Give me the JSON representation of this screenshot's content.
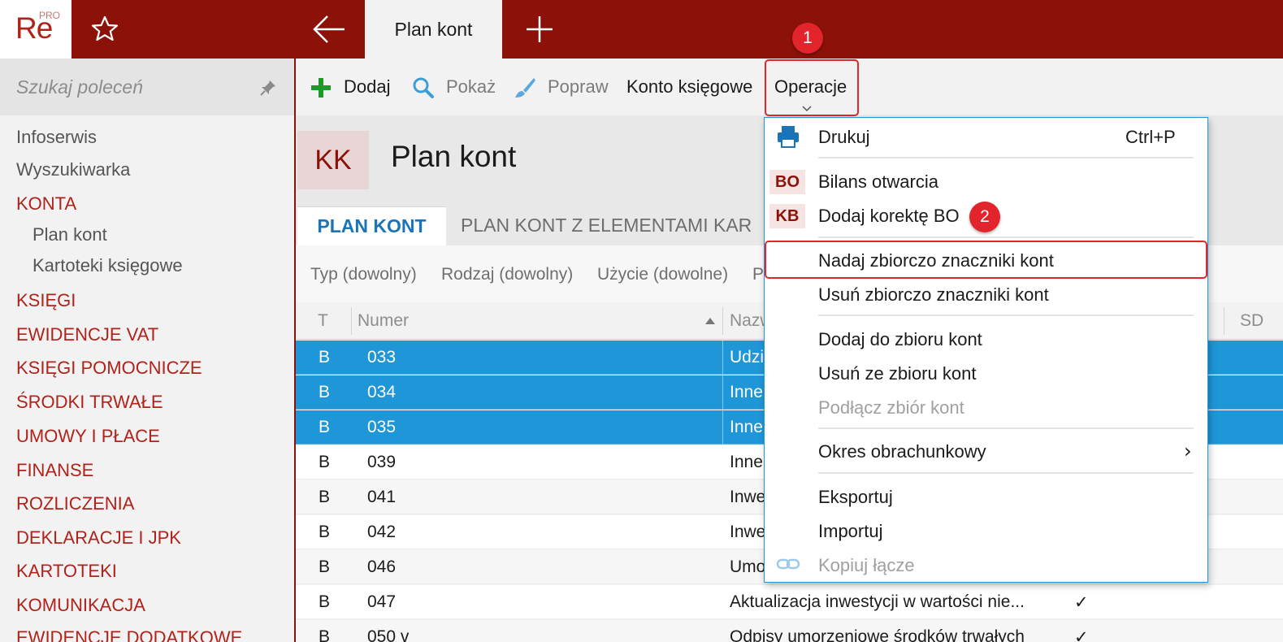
{
  "app": {
    "logo_text": "Re",
    "logo_badge": "PRO"
  },
  "topbar": {
    "active_tab": "Plan kont"
  },
  "sidebar": {
    "search_placeholder": "Szukaj poleceń",
    "items": [
      {
        "label": "Infoserwis"
      },
      {
        "label": "Wyszukiwarka"
      },
      {
        "label": "KONTA"
      },
      {
        "label": "Plan kont"
      },
      {
        "label": "Kartoteki księgowe"
      },
      {
        "label": "KSIĘGI"
      },
      {
        "label": "EWIDENCJE VAT"
      },
      {
        "label": "KSIĘGI POMOCNICZE"
      },
      {
        "label": "ŚRODKI TRWAŁE"
      },
      {
        "label": "UMOWY I PŁACE"
      },
      {
        "label": "FINANSE"
      },
      {
        "label": "ROZLICZENIA"
      },
      {
        "label": "DEKLARACJE I JPK"
      },
      {
        "label": "KARTOTEKI"
      },
      {
        "label": "KOMUNIKACJA"
      },
      {
        "label": "EWIDENCJE DODATKOWE"
      }
    ]
  },
  "toolbar": {
    "add": "Dodaj",
    "show": "Pokaż",
    "edit": "Popraw",
    "account": "Konto księgowe",
    "operations": "Operacje"
  },
  "page": {
    "badge": "KK",
    "title": "Plan kont",
    "tabs": [
      "PLAN KONT",
      "PLAN KONT Z ELEMENTAMI KAR"
    ]
  },
  "filters": [
    "Typ (dowolny)",
    "Rodzaj (dowolny)",
    "Użycie (dowolne)",
    "P"
  ],
  "grid": {
    "headers": {
      "t": "T",
      "numer": "Numer",
      "nazwa": "Nazw",
      "sd": "SD"
    },
    "rows": [
      {
        "t": "B",
        "numer": "033",
        "nazwa": "Udzi",
        "mark": ""
      },
      {
        "t": "B",
        "numer": "034",
        "nazwa": "Inne",
        "mark": ""
      },
      {
        "t": "B",
        "numer": "035",
        "nazwa": "Inne",
        "mark": ""
      },
      {
        "t": "B",
        "numer": "039",
        "nazwa": "Inne",
        "mark": ""
      },
      {
        "t": "B",
        "numer": "041",
        "nazwa": "Inwe",
        "mark": ""
      },
      {
        "t": "B",
        "numer": "042",
        "nazwa": "Inwe",
        "mark": ""
      },
      {
        "t": "B",
        "numer": "046",
        "nazwa": "Umo",
        "mark": ""
      },
      {
        "t": "B",
        "numer": "047",
        "nazwa": "Aktualizacja inwestycji w wartości nie...",
        "mark": "✓"
      },
      {
        "t": "B",
        "numer": "050 v",
        "nazwa": "Odpisy umorzeniowe środków trwałych",
        "mark": "✓"
      }
    ]
  },
  "menu": {
    "print": "Drukuj",
    "print_shortcut": "Ctrl+P",
    "bo_badge": "BO",
    "opening_balance": "Bilans otwarcia",
    "kb_badge": "KB",
    "add_correction": "Dodaj korektę BO",
    "assign_tags": "Nadaj zbiorczo znaczniki kont",
    "remove_tags": "Usuń zbiorczo znaczniki kont",
    "add_to_set": "Dodaj do zbioru kont",
    "remove_from_set": "Usuń ze zbioru kont",
    "attach_set": "Podłącz zbiór kont",
    "period": "Okres obrachunkowy",
    "export": "Eksportuj",
    "import": "Importuj",
    "copy_link": "Kopiuj łącze"
  },
  "callouts": {
    "first": "1",
    "second": "2"
  },
  "colors": {
    "brand": "#8b1109",
    "accent": "#b1221a",
    "selection": "#1f96d8",
    "callout": "#e2242c",
    "link": "#1a74b8"
  }
}
